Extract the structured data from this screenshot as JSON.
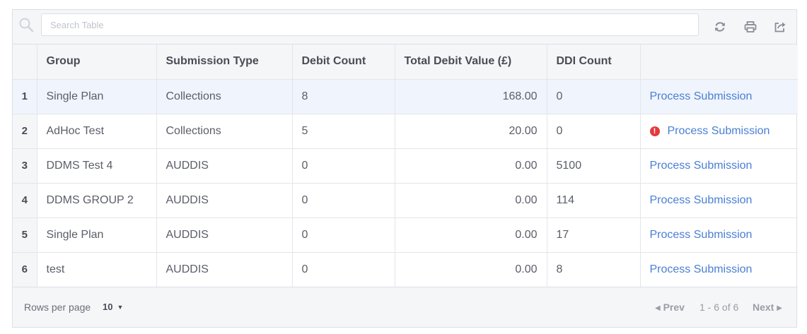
{
  "search": {
    "placeholder": "Search Table",
    "value": ""
  },
  "toolbar": {
    "refresh_icon": "refresh-icon",
    "print_icon": "print-icon",
    "export_icon": "export-icon"
  },
  "table": {
    "columns": [
      "Group",
      "Submission Type",
      "Debit Count",
      "Total Debit Value (£)",
      "DDI Count",
      ""
    ],
    "rows": [
      {
        "index": "1",
        "group": "Single Plan",
        "type": "Collections",
        "debit_count": "8",
        "total": "168.00",
        "ddi": "0",
        "action": "Process Submission",
        "warning": false
      },
      {
        "index": "2",
        "group": "AdHoc Test",
        "type": "Collections",
        "debit_count": "5",
        "total": "20.00",
        "ddi": "0",
        "action": "Process Submission",
        "warning": true
      },
      {
        "index": "3",
        "group": "DDMS Test 4",
        "type": "AUDDIS",
        "debit_count": "0",
        "total": "0.00",
        "ddi": "5100",
        "action": "Process Submission",
        "warning": false
      },
      {
        "index": "4",
        "group": "DDMS GROUP 2",
        "type": "AUDDIS",
        "debit_count": "0",
        "total": "0.00",
        "ddi": "114",
        "action": "Process Submission",
        "warning": false
      },
      {
        "index": "5",
        "group": "Single Plan",
        "type": "AUDDIS",
        "debit_count": "0",
        "total": "0.00",
        "ddi": "17",
        "action": "Process Submission",
        "warning": false
      },
      {
        "index": "6",
        "group": "test",
        "type": "AUDDIS",
        "debit_count": "0",
        "total": "0.00",
        "ddi": "8",
        "action": "Process Submission",
        "warning": false
      }
    ]
  },
  "footer": {
    "rows_per_page_label": "Rows per page",
    "rows_per_page_value": "10",
    "prev_label": "Prev",
    "next_label": "Next",
    "page_info": "1 - 6 of 6"
  },
  "colors": {
    "link": "#4a7fd4",
    "warning": "#e5393f",
    "selected_row": "#f0f4fc"
  }
}
